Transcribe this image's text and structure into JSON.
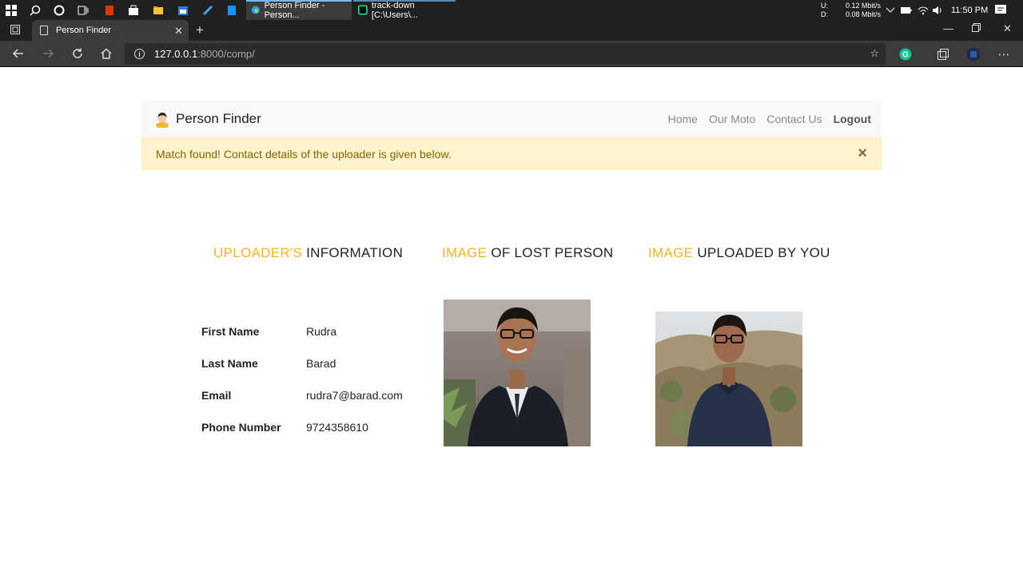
{
  "taskbar": {
    "apps": [
      {
        "title": "Person Finder - Person..."
      },
      {
        "title": "track-down [C:\\Users\\..."
      }
    ],
    "network": {
      "up_label": "U:",
      "down_label": "D:",
      "up": "0.12 Mbit/s",
      "down": "0.08 Mbit/s"
    },
    "clock": "11:50 PM"
  },
  "browser": {
    "tab_title": "Person Finder",
    "url_host": "127.0.0.1",
    "url_path": ":8000/comp/"
  },
  "navbar": {
    "brand": "Person Finder",
    "links": [
      "Home",
      "Our Moto",
      "Contact Us",
      "Logout"
    ]
  },
  "alert": {
    "message": "Match found! Contact details of the uploader is given below.",
    "close": "×"
  },
  "headings": [
    {
      "highlight": "UPLOADER'S",
      "rest": " INFORMATION"
    },
    {
      "highlight": "IMAGE",
      "rest": " OF LOST PERSON"
    },
    {
      "highlight": "IMAGE",
      "rest": " UPLOADED BY YOU"
    }
  ],
  "uploader": {
    "rows": [
      {
        "label": "First Name",
        "value": "Rudra"
      },
      {
        "label": "Last Name",
        "value": "Barad"
      },
      {
        "label": "Email",
        "value": "rudra7@barad.com"
      },
      {
        "label": "Phone Number",
        "value": "9724358610"
      }
    ]
  },
  "colors": {
    "highlight": "#f0b429",
    "alert_bg": "#fff3cd",
    "alert_text": "#856404"
  }
}
